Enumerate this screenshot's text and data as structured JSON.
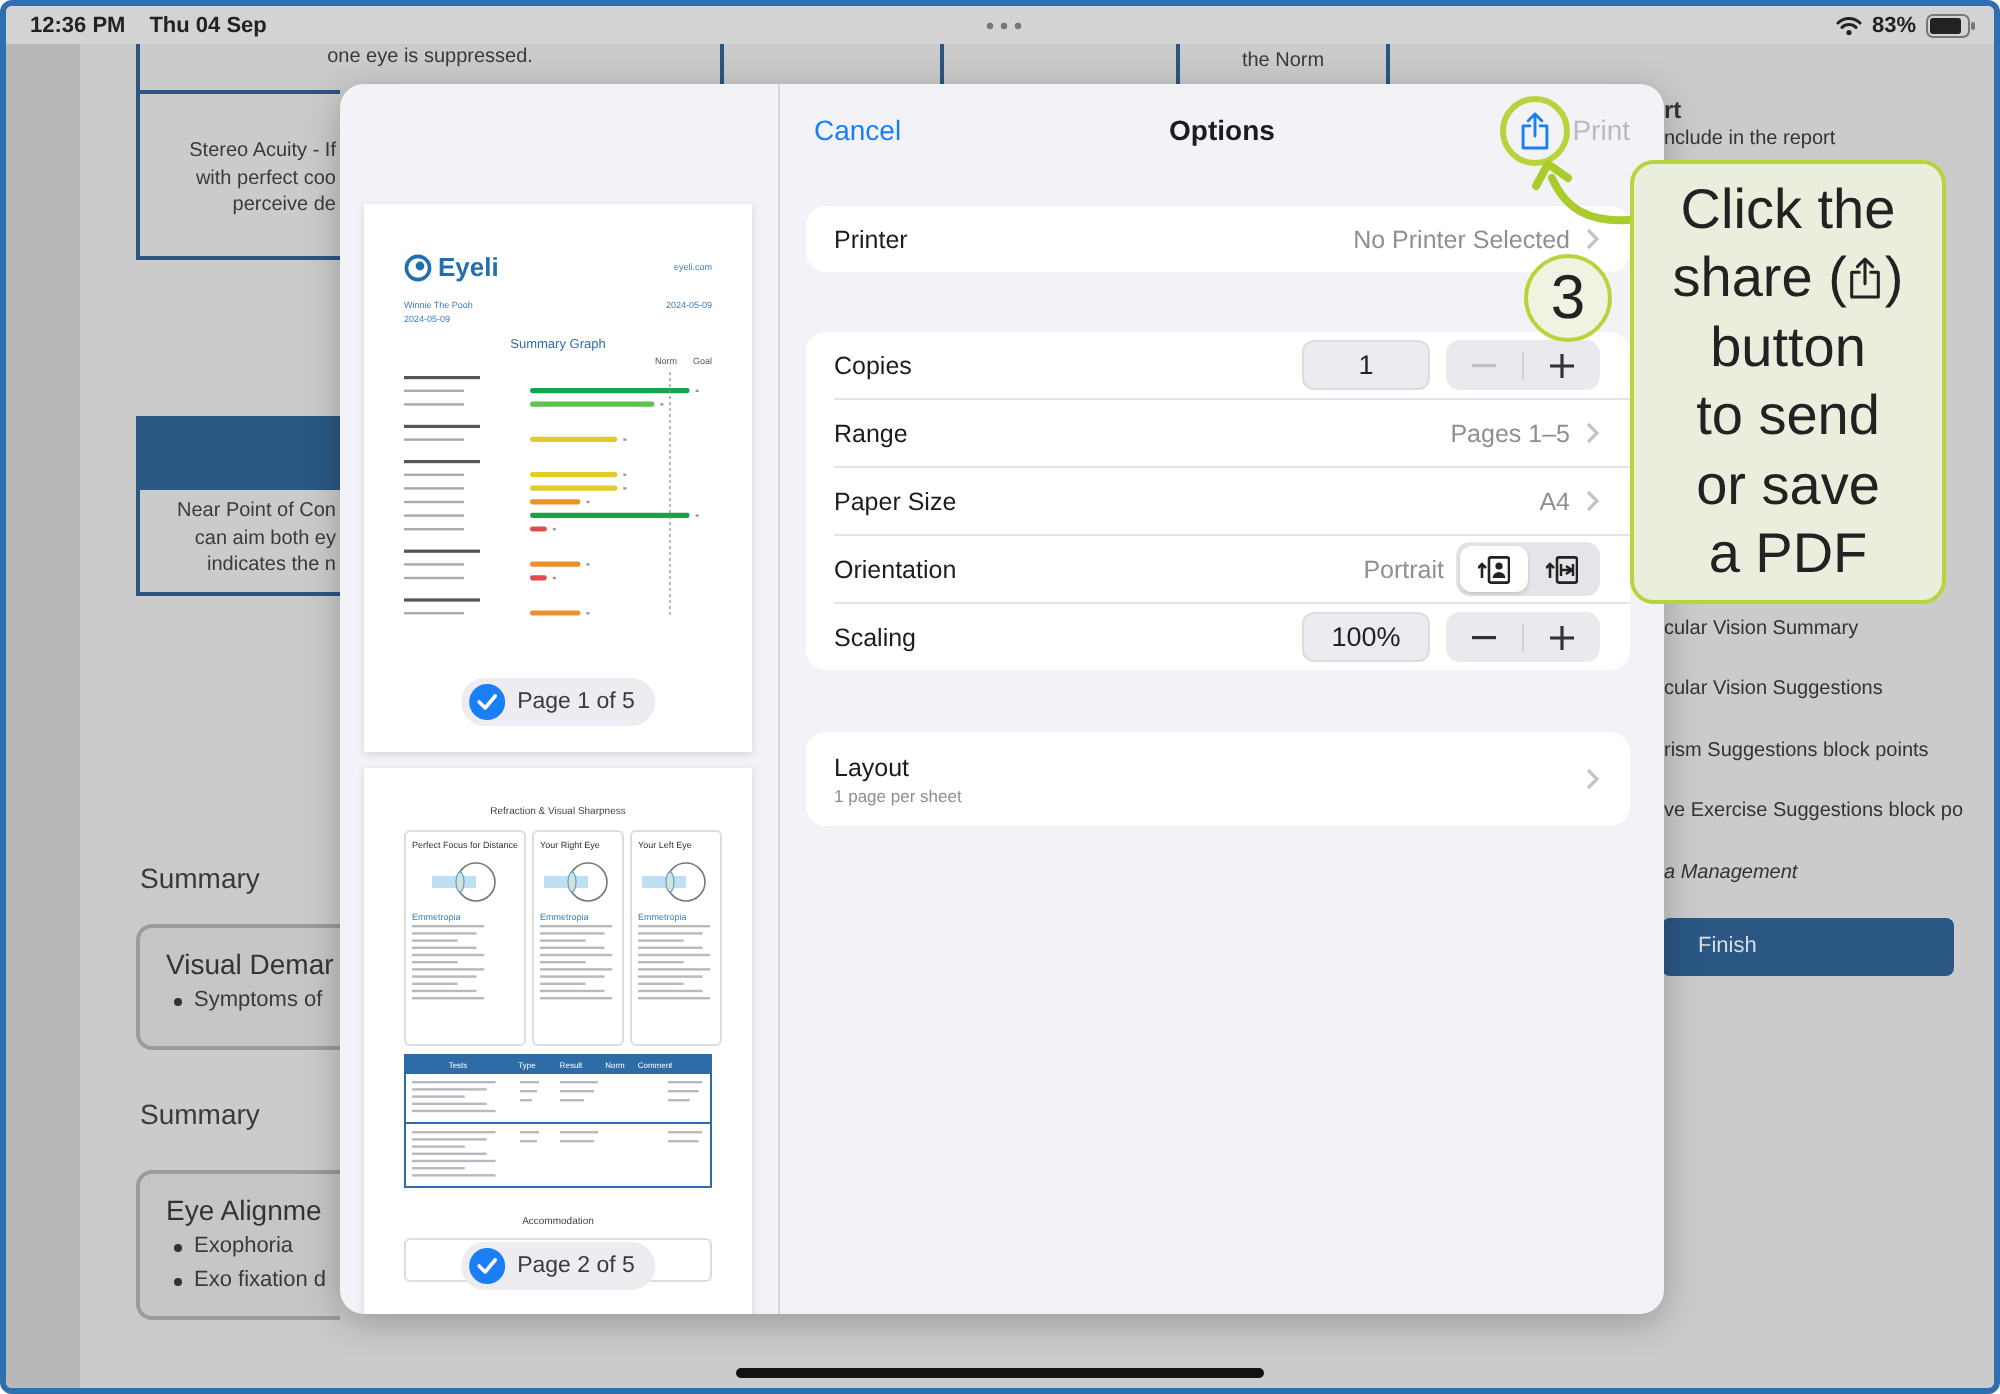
{
  "status_bar": {
    "time": "12:36 PM",
    "date": "Thu 04 Sep",
    "battery": "83%"
  },
  "report": {
    "table_row": [
      "one eye is suppressed.",
      "the Norm"
    ],
    "stereo_acuity": [
      "Stereo Acuity - If",
      "with perfect coo",
      "perceive de"
    ],
    "near_point": [
      "Near Point of Con",
      "can aim both ey",
      "indicates the n"
    ],
    "summaries": [
      {
        "heading": "Summary",
        "title": "Visual Demar",
        "bullets": [
          "Symptoms of"
        ]
      },
      {
        "heading": "Summary",
        "title": "Eye Alignme",
        "bullets": [
          "Exophoria",
          "Exo fixation d"
        ]
      }
    ]
  },
  "report_panel": {
    "title": "rt",
    "subtitle": "nclude in the report",
    "items": [
      {
        "label": "cular Vision Summary",
        "italic": false
      },
      {
        "label": "cular Vision Suggestions",
        "italic": false
      },
      {
        "label": "rism Suggestions block points",
        "italic": false
      },
      {
        "label": "ve Exercise Suggestions block po",
        "italic": false
      },
      {
        "label": "a Management",
        "italic": true
      }
    ],
    "finish_button": "Finish"
  },
  "print_dialog": {
    "cancel": "Cancel",
    "title": "Options",
    "print": "Print",
    "print_disabled": true,
    "previews": [
      {
        "kind": "summary",
        "label": "Page 1 of 5",
        "selected": true,
        "logo": "Eyeli",
        "website": "eyeli.com",
        "patient": "Winnie The Pooh",
        "date": "2024-05-09",
        "report_date": "2024-05-09",
        "heading": "Summary Graph",
        "legend": [
          "Norm",
          "Goal"
        ]
      },
      {
        "kind": "refraction",
        "label": "Page 2 of 5",
        "selected": true,
        "heading": "Refraction & Visual Sharpness",
        "cards": [
          {
            "title": "Perfect Focus for Distance",
            "diagnosis": "Emmetropia"
          },
          {
            "title": "Your Right Eye",
            "diagnosis": "Emmetropia"
          },
          {
            "title": "Your Left Eye",
            "diagnosis": "Emmetropia"
          }
        ],
        "table_columns": [
          "Tests",
          "Type",
          "Result",
          "Norm",
          "Comment"
        ],
        "next_heading": "Accommodation"
      }
    ],
    "sections": [
      {
        "rows": [
          {
            "kind": "value",
            "label": "Printer",
            "value": "No Printer Selected"
          }
        ]
      },
      {
        "rows": [
          {
            "kind": "stepper",
            "label": "Copies",
            "value": "1",
            "minus_disabled": true
          },
          {
            "kind": "value",
            "label": "Range",
            "value": "Pages 1–5"
          },
          {
            "kind": "value",
            "label": "Paper Size",
            "value": "A4"
          },
          {
            "kind": "segmented",
            "label": "Orientation",
            "value": "Portrait",
            "options": [
              {
                "kind": "portrait",
                "selected": true
              },
              {
                "kind": "landscape",
                "selected": false
              }
            ]
          },
          {
            "kind": "stepper",
            "label": "Scaling",
            "value": "100%",
            "minus_disabled": false
          }
        ]
      },
      {
        "rows": [
          {
            "kind": "detail",
            "label": "Layout",
            "detail": "1 page per sheet"
          }
        ]
      }
    ]
  },
  "annotation": {
    "step": "3",
    "text_before": "Click the\nshare (",
    "text_after": ")\nbutton\nto send\nor save\na PDF"
  }
}
